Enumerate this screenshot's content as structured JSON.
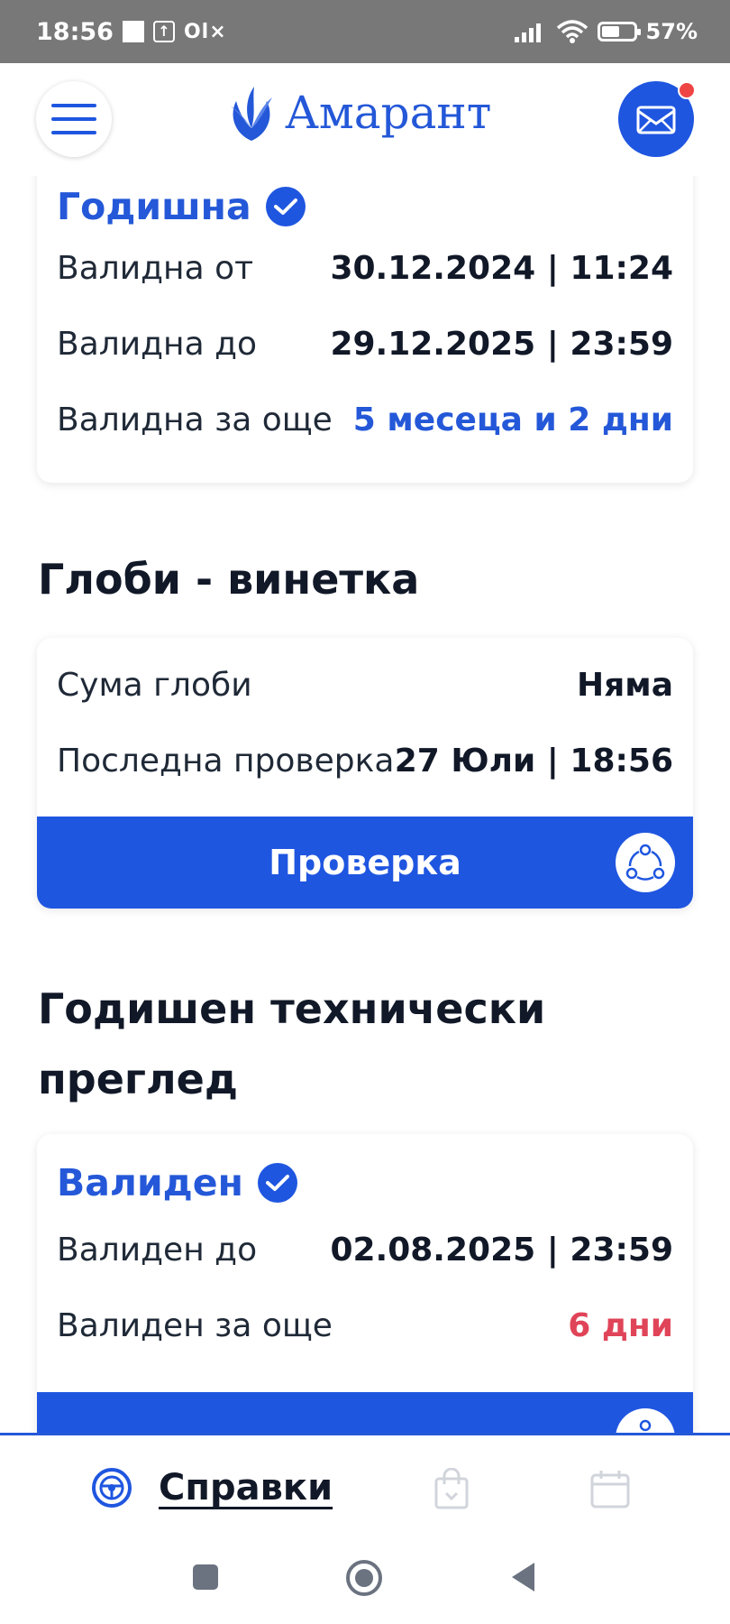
{
  "status_bar": {
    "time": "18:56",
    "notif_olx": "Ol×",
    "battery_percent": "57%"
  },
  "header": {
    "logo_text": "Амарант",
    "has_new_message": true,
    "menu_icon": "hamburger-menu-icon",
    "mail_icon": "mail-icon"
  },
  "vignette": {
    "status": "Годишна",
    "rows": [
      {
        "label": "Валидна от",
        "value": "30.12.2024 | 11:24"
      },
      {
        "label": "Валидна до",
        "value": "29.12.2025 | 23:59"
      },
      {
        "label": "Валидна за още",
        "value": "5 месеца и 2 дни"
      }
    ]
  },
  "fines": {
    "title": "Глоби - винетка",
    "rows": [
      {
        "label": "Сума глоби",
        "value": "Няма"
      },
      {
        "label": "Последна проверка",
        "value": "27 Юли | 18:56"
      }
    ],
    "action_label": "Проверка"
  },
  "inspection": {
    "title_line1": "Годишен технически",
    "title_line2": "преглед",
    "status": "Валиден",
    "rows": [
      {
        "label": "Валиден до",
        "value": "02.08.2025 | 23:59"
      },
      {
        "label": "Валиден за още",
        "value": "6 дни"
      }
    ]
  },
  "tab_bar": {
    "active_label": "Справки",
    "tabs": [
      "steering-wheel-icon",
      "shopping-bag-icon",
      "calendar-icon"
    ]
  },
  "colors": {
    "primary": "#1f56e0",
    "accent_text": "#2458d8",
    "danger": "#e04458",
    "status_bar": "#787878"
  }
}
